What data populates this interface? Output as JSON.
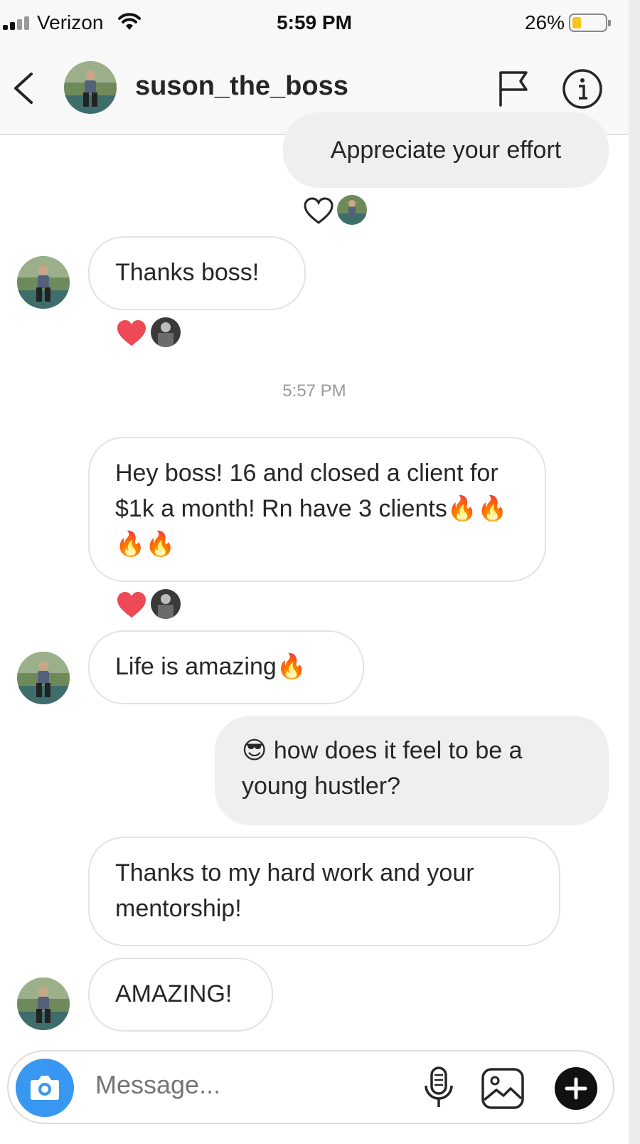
{
  "status_bar": {
    "carrier": "Verizon",
    "time": "5:59 PM",
    "battery_percent": "26%",
    "battery_level": 0.26,
    "battery_color": "#f5c518"
  },
  "header": {
    "username": "suson_the_boss",
    "back_icon": "chevron-left-icon",
    "flag_icon": "flag-icon",
    "info_icon": "info-icon"
  },
  "messages": [
    {
      "side": "sent",
      "text": "Appreciate your effort",
      "reaction": "heart-outline"
    },
    {
      "side": "received",
      "text": "Thanks boss!",
      "reaction": "heart-red"
    },
    {
      "side": "received",
      "text": "Hey boss! 16 and closed a client for $1k a month! Rn have 3 clients🔥🔥🔥🔥",
      "reaction": "heart-red"
    },
    {
      "side": "received",
      "text": "Life is amazing🔥"
    },
    {
      "side": "sent",
      "text": "😎 how does it feel to be a young hustler?"
    },
    {
      "side": "received",
      "text": "Thanks to my hard work and your mentorship!"
    },
    {
      "side": "received",
      "text": "AMAZING!"
    }
  ],
  "timestamp": "5:57 PM",
  "composer": {
    "placeholder": "Message...",
    "camera_icon": "camera-icon",
    "mic_icon": "microphone-icon",
    "gallery_icon": "gallery-icon",
    "plus_icon": "plus-icon",
    "accent_color": "#3897f0"
  },
  "colors": {
    "like_red": "#ed4956",
    "sent_bubble": "#efefef"
  }
}
